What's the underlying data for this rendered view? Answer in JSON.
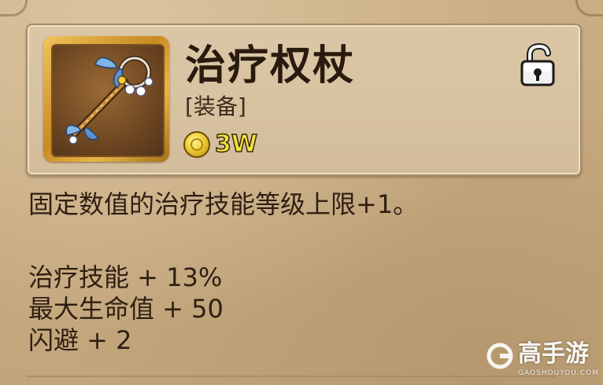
{
  "item": {
    "name": "治疗权杖",
    "type": "[装备]",
    "price": "3W",
    "icon": "healing-staff-icon",
    "locked": true
  },
  "description": "固定数值的治疗技能等级上限+1。",
  "stats": [
    {
      "text": "治疗技能 + 13%"
    },
    {
      "text": "最大生命值 + 50"
    },
    {
      "text": "闪避 + 2"
    }
  ],
  "watermark": {
    "text": "高手游",
    "sub": "GAOSHOUYOU.COM"
  },
  "colors": {
    "panel": "#d8c4a3",
    "background": "#c6a97f",
    "price": "#f3e23a",
    "frame_gold": "#d8a23a"
  }
}
